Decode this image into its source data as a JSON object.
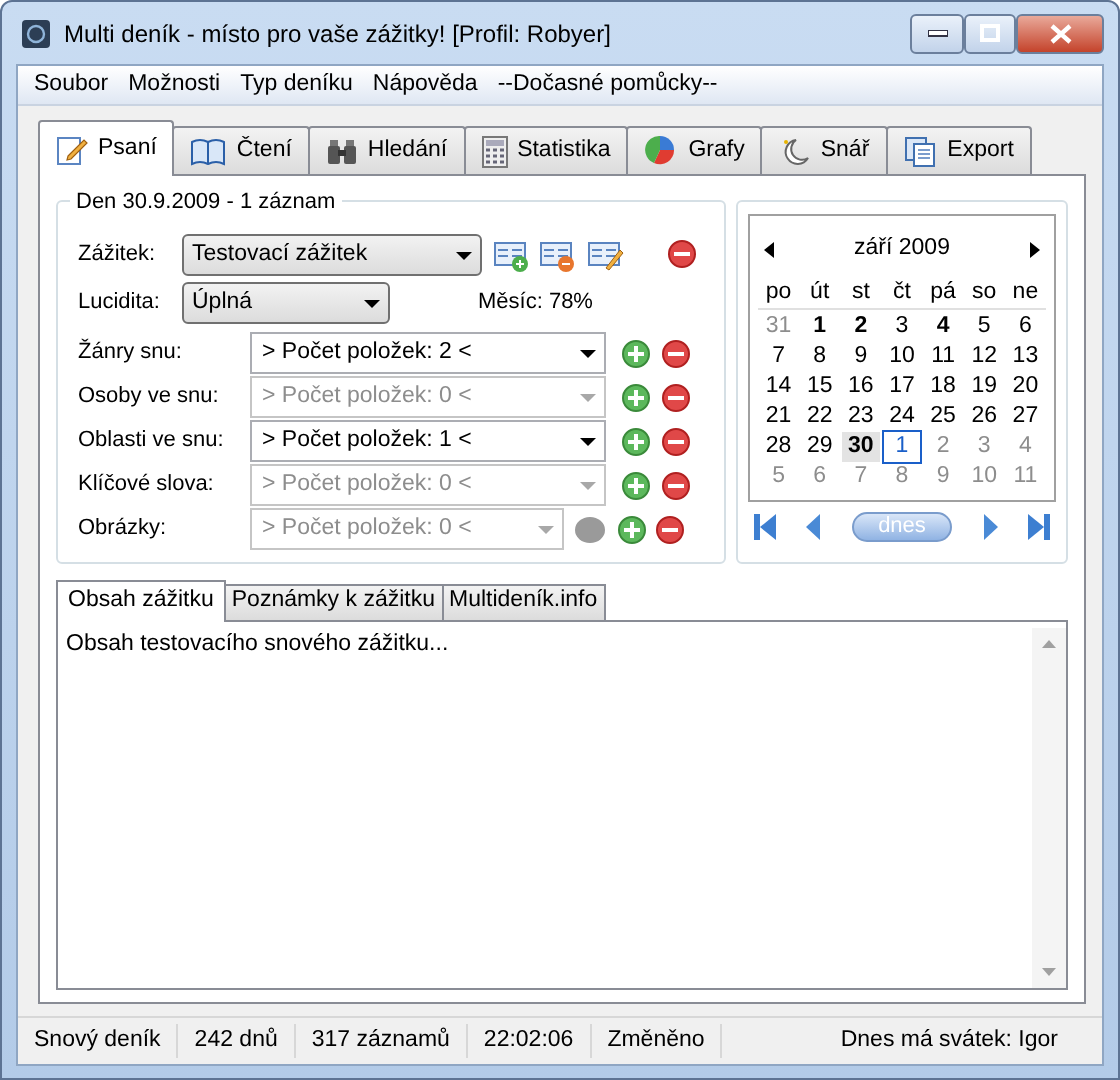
{
  "window": {
    "title": "Multi deník - místo pro vaše zážitky! [Profil: Robyer]"
  },
  "menu": [
    "Soubor",
    "Možnosti",
    "Typ deníku",
    "Nápověda",
    "--Dočasné pomůcky--"
  ],
  "tabs": [
    {
      "label": "Psaní",
      "selected": true,
      "kind": "pencil"
    },
    {
      "label": "Čtení",
      "selected": false,
      "kind": "book"
    },
    {
      "label": "Hledání",
      "selected": false,
      "kind": "binoculars"
    },
    {
      "label": "Statistika",
      "selected": false,
      "kind": "calculator"
    },
    {
      "label": "Grafy",
      "selected": false,
      "kind": "pie"
    },
    {
      "label": "Snář",
      "selected": false,
      "kind": "moon"
    },
    {
      "label": "Export",
      "selected": false,
      "kind": "pages"
    }
  ],
  "day_group": {
    "title": "Den 30.9.2009 - 1 záznam",
    "experience": {
      "label": "Zážitek:",
      "value": "Testovací zážitek"
    },
    "lucidity": {
      "label": "Lucidita:",
      "value": "Úplná"
    },
    "moon": "Měsíc: 78%",
    "lists": [
      {
        "label": "Žánry snu:",
        "value": "> Počet položek: 2 <",
        "disabled": false
      },
      {
        "label": "Osoby ve snu:",
        "value": "> Počet položek: 0 <",
        "disabled": true
      },
      {
        "label": "Oblasti ve snu:",
        "value": "> Počet položek: 1 <",
        "disabled": false
      },
      {
        "label": "Klíčové slova:",
        "value": "> Počet položek: 0 <",
        "disabled": true
      },
      {
        "label": "Obrázky:",
        "value": "> Počet položek: 0 <",
        "disabled": true,
        "kind": "picture"
      }
    ]
  },
  "calendar": {
    "month": "září 2009",
    "weekdays": [
      "po",
      "út",
      "st",
      "čt",
      "pá",
      "so",
      "ne"
    ],
    "weeks": [
      [
        {
          "d": "31",
          "other": true
        },
        {
          "d": "1",
          "bold": true
        },
        {
          "d": "2",
          "bold": true
        },
        {
          "d": "3"
        },
        {
          "d": "4",
          "bold": true
        },
        {
          "d": "5"
        },
        {
          "d": "6"
        }
      ],
      [
        {
          "d": "7"
        },
        {
          "d": "8"
        },
        {
          "d": "9"
        },
        {
          "d": "10"
        },
        {
          "d": "11"
        },
        {
          "d": "12"
        },
        {
          "d": "13"
        }
      ],
      [
        {
          "d": "14"
        },
        {
          "d": "15"
        },
        {
          "d": "16"
        },
        {
          "d": "17"
        },
        {
          "d": "18"
        },
        {
          "d": "19"
        },
        {
          "d": "20"
        }
      ],
      [
        {
          "d": "21"
        },
        {
          "d": "22"
        },
        {
          "d": "23"
        },
        {
          "d": "24"
        },
        {
          "d": "25"
        },
        {
          "d": "26"
        },
        {
          "d": "27"
        }
      ],
      [
        {
          "d": "28"
        },
        {
          "d": "29"
        },
        {
          "d": "30",
          "bold": true,
          "selected": true
        },
        {
          "d": "1",
          "other": true,
          "today": true
        },
        {
          "d": "2",
          "other": true
        },
        {
          "d": "3",
          "other": true
        },
        {
          "d": "4",
          "other": true
        }
      ],
      [
        {
          "d": "5",
          "other": true
        },
        {
          "d": "6",
          "other": true
        },
        {
          "d": "7",
          "other": true
        },
        {
          "d": "8",
          "other": true
        },
        {
          "d": "9",
          "other": true
        },
        {
          "d": "10",
          "other": true
        },
        {
          "d": "11",
          "other": true
        }
      ]
    ],
    "today_button": "dnes"
  },
  "content_tabs": [
    {
      "label": "Obsah zážitku",
      "selected": true
    },
    {
      "label": "Poznámky k zážitku",
      "selected": false
    },
    {
      "label": "Multideník.info",
      "selected": false
    }
  ],
  "content": "Obsah testovacího snového zážitku...",
  "status_bar": [
    "Snový deník",
    "242 dnů",
    "317 záznamů",
    "22:02:06",
    "Změněno",
    "Dnes má svátek: Igor"
  ]
}
